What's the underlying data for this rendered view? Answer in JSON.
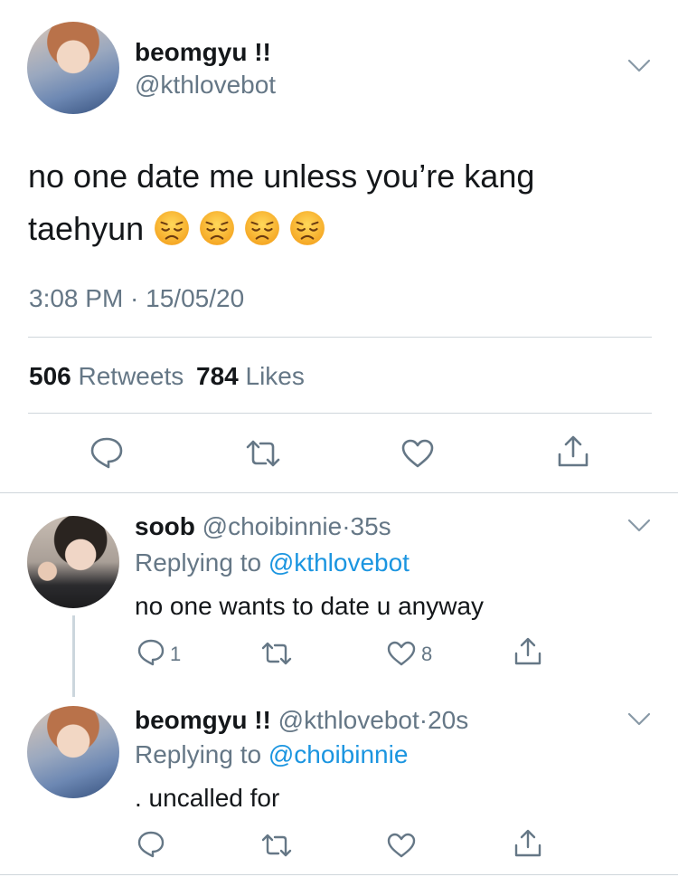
{
  "main_tweet": {
    "display_name": "beomgyu !!",
    "handle": "@kthlovebot",
    "text": "no one date me unless you’re kang taehyun",
    "text_line1": "no one date me unless you’re kang",
    "text_line2": "taehyun",
    "emoji_count": 4,
    "timestamp": "3:08 PM · 15/05/20",
    "retweets_count": "506",
    "retweets_label": "Retweets",
    "likes_count": "784",
    "likes_label": "Likes"
  },
  "replies": [
    {
      "display_name": "soob",
      "handle": "@choibinnie",
      "time": "35s",
      "replying_prefix": "Replying to",
      "replying_to": "@kthlovebot",
      "text": "no one wants to date u anyway",
      "reply_count": "1",
      "like_count": "8"
    },
    {
      "display_name": "beomgyu !!",
      "handle": "@kthlovebot",
      "time": "20s",
      "replying_prefix": "Replying to",
      "replying_to": "@choibinnie",
      "text": ". uncalled for"
    }
  ],
  "icons": [
    "chevron-down-icon",
    "reply-icon",
    "retweet-icon",
    "like-icon",
    "share-icon",
    "disappointed-face-emoji"
  ],
  "colors": {
    "text": "#14171a",
    "secondary": "#657786",
    "link": "#1b95e0",
    "divider": "#cfd6db"
  }
}
